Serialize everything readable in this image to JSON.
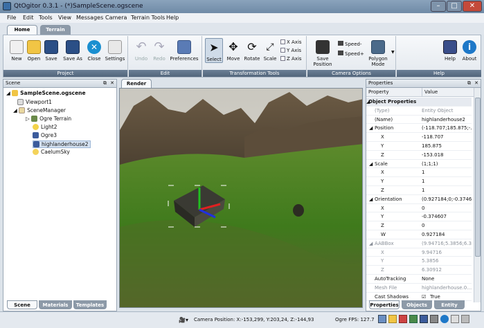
{
  "window": {
    "title": "QtOgitor 0.3.1 - (*)SampleScene.ogscene"
  },
  "menu": [
    "File",
    "Edit",
    "Tools",
    "View",
    "Messages",
    "Camera",
    "Terrain Tools",
    "Help"
  ],
  "tabs": [
    "Home",
    "Terrain"
  ],
  "groups": {
    "project": "Project",
    "edit": "Edit",
    "transform": "Transformation Tools",
    "camera": "Camera Options",
    "help": "Help"
  },
  "buttons": {
    "new": "New",
    "open": "Open",
    "save": "Save",
    "save_as": "Save As",
    "close": "Close",
    "settings": "Settings",
    "undo": "Undo",
    "redo": "Redo",
    "preferences": "Preferences",
    "select": "Select",
    "move": "Move",
    "rotate": "Rotate",
    "scale": "Scale",
    "save_position": "Save Position",
    "speed_minus": "Speed-",
    "speed_plus": "Speed+",
    "polygon_mode": "Polygon Mode",
    "help": "Help",
    "about": "About"
  },
  "axes": {
    "x": "X Axis",
    "y": "Y Axis",
    "z": "Z Axis"
  },
  "scene": {
    "title": "Scene",
    "items": {
      "root": "SampleScene.ogscene",
      "viewport": "Viewport1",
      "manager": "SceneManager",
      "terrain": "Ogre Terrain",
      "light": "Light2",
      "ogre": "Ogre3",
      "house": "highlanderhouse2",
      "sky": "CaelumSky"
    },
    "bottom_tabs": [
      "Scene",
      "Materials",
      "Templates"
    ]
  },
  "render": {
    "tab": "Render"
  },
  "properties": {
    "title": "Properties",
    "col_property": "Property",
    "col_value": "Value",
    "rows": [
      {
        "k": "Object Properties",
        "v": "",
        "t": "sec",
        "i": 0
      },
      {
        "k": "(Type)",
        "v": "Entity Object",
        "t": "gray",
        "i": 1
      },
      {
        "k": "(Name)",
        "v": "highlanderhouse2",
        "t": "",
        "i": 1
      },
      {
        "k": "Position",
        "v": "(-118.707;185.875;-…",
        "t": "grp",
        "i": 1
      },
      {
        "k": "X",
        "v": "-118.707",
        "t": "",
        "i": 2
      },
      {
        "k": "Y",
        "v": "185.875",
        "t": "",
        "i": 2
      },
      {
        "k": "Z",
        "v": "-153.018",
        "t": "",
        "i": 2
      },
      {
        "k": "Scale",
        "v": "(1;1;1)",
        "t": "grp",
        "i": 1
      },
      {
        "k": "X",
        "v": "1",
        "t": "",
        "i": 2
      },
      {
        "k": "Y",
        "v": "1",
        "t": "",
        "i": 2
      },
      {
        "k": "Z",
        "v": "1",
        "t": "",
        "i": 2
      },
      {
        "k": "Orientation",
        "v": "(0.927184;0;-0.3746…",
        "t": "grp",
        "i": 1
      },
      {
        "k": "X",
        "v": "0",
        "t": "",
        "i": 2
      },
      {
        "k": "Y",
        "v": "-0.374607",
        "t": "",
        "i": 2
      },
      {
        "k": "Z",
        "v": "0",
        "t": "",
        "i": 2
      },
      {
        "k": "W",
        "v": "0.927184",
        "t": "",
        "i": 2
      },
      {
        "k": "AABBox",
        "v": "(9.94716;5.3856;6.3…",
        "t": "gray grp",
        "i": 1
      },
      {
        "k": "X",
        "v": "9.94716",
        "t": "gray",
        "i": 2
      },
      {
        "k": "Y",
        "v": "5.3856",
        "t": "gray",
        "i": 2
      },
      {
        "k": "Z",
        "v": "6.30912",
        "t": "gray",
        "i": 2
      },
      {
        "k": "AutoTracking",
        "v": "None",
        "t": "",
        "i": 1
      },
      {
        "k": "Mesh File",
        "v": "highlanderhouse.0…",
        "t": "gray",
        "i": 1
      },
      {
        "k": "Cast Shadows",
        "v": "True",
        "t": "chk",
        "i": 1
      }
    ],
    "bottom_tabs": [
      "Properties",
      "Objects",
      "Entity"
    ]
  },
  "status": {
    "camera": "Camera Position: X:-153,299, Y:203,24, Z:-144,93",
    "fps": "Ogre FPS:  127.7"
  }
}
